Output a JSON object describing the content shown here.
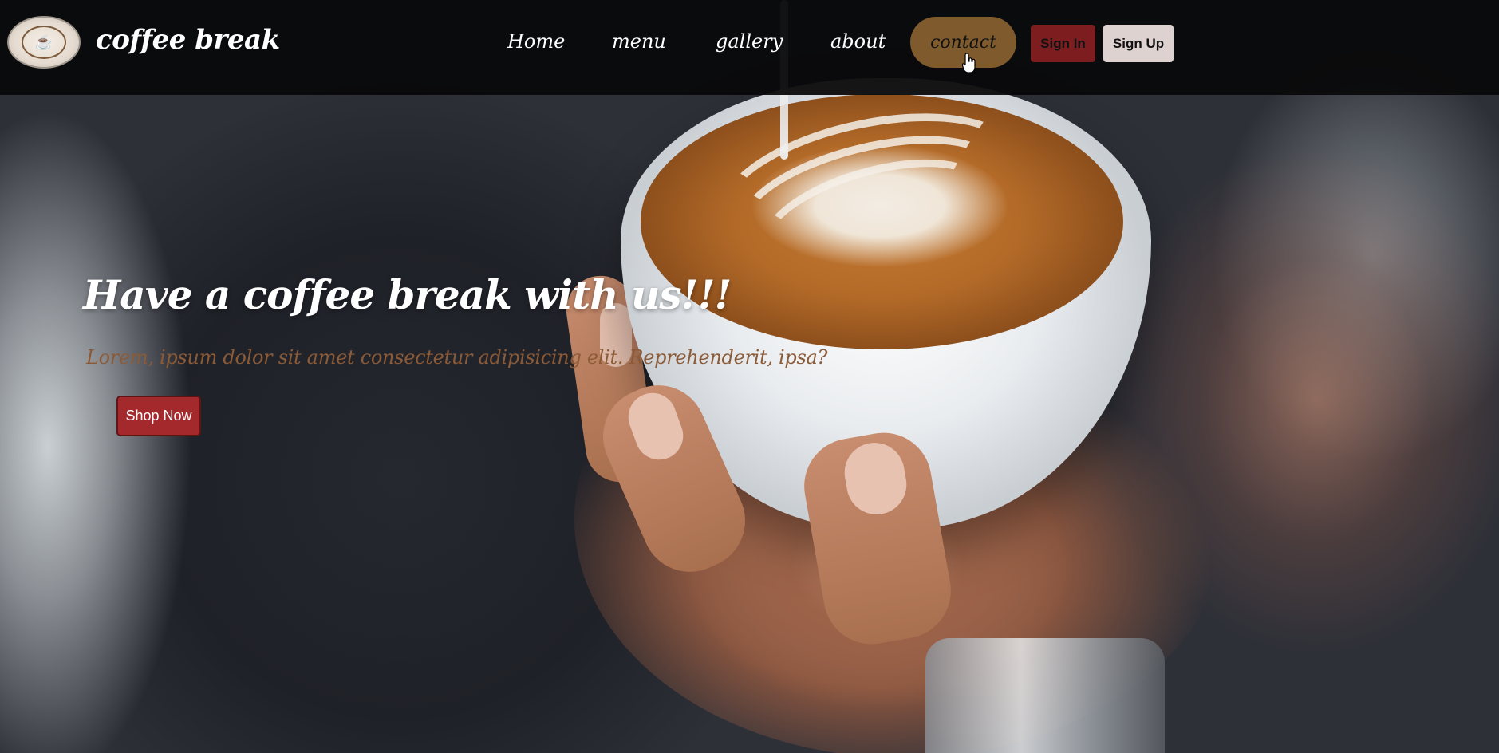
{
  "header": {
    "brand": "coffee break",
    "nav": {
      "home": "Home",
      "menu": "menu",
      "gallery": "gallery",
      "about": "about",
      "contact": "contact"
    },
    "sign_in": "Sign In",
    "sign_up": "Sign Up"
  },
  "hero": {
    "title": "Have a coffee break with us!!!",
    "subtitle": "Lorem, ipsum dolor sit amet consectetur adipisicing elit. Reprehenderit, ipsa?",
    "button": "Shop Now"
  },
  "colors": {
    "navbar_bg": "#08080a",
    "contact_pill": "#7f5a2d",
    "sign_in_bg": "#7d1d1f",
    "sign_up_bg": "#ddd2cf",
    "shop_button": "#a4292c",
    "subtitle_text": "#8b5a37"
  },
  "icons": {
    "logo": "coffee-cup-logo",
    "cursor": "hand-pointer-cursor"
  }
}
